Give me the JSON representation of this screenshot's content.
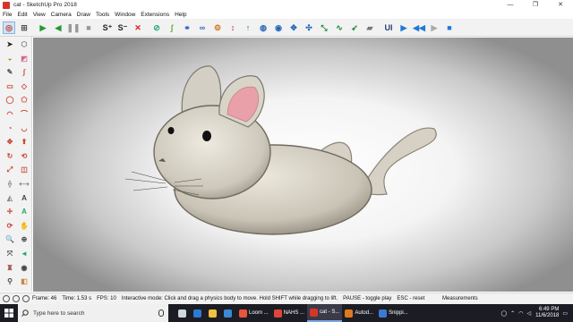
{
  "window": {
    "title": "cat - SketchUp Pro 2018",
    "min": "—",
    "restore": "❐",
    "close": "✕"
  },
  "menu": [
    "File",
    "Edit",
    "View",
    "Camera",
    "Draw",
    "Tools",
    "Window",
    "Extensions",
    "Help"
  ],
  "toolbar": {
    "items": [
      {
        "name": "select-tool",
        "glyph": "◎",
        "color": "#c0392b",
        "selected": true
      },
      {
        "name": "physics-icon",
        "glyph": "⊞",
        "color": "#555"
      },
      {
        "name": "play-button",
        "glyph": "▶",
        "color": "#1e9c2e"
      },
      {
        "name": "step-back-button",
        "glyph": "◀",
        "color": "#1e9c2e"
      },
      {
        "name": "pause-button",
        "glyph": "❚❚",
        "color": "#999"
      },
      {
        "name": "stop-button",
        "glyph": "■",
        "color": "#999"
      },
      {
        "name": "sound-plus-button",
        "glyph": "S⁺",
        "color": "#222"
      },
      {
        "name": "sound-minus-button",
        "glyph": "S⁻",
        "color": "#222"
      },
      {
        "name": "delete-joint-button",
        "glyph": "✕",
        "color": "#d22"
      },
      {
        "name": "reset-icon",
        "glyph": "⊘",
        "color": "#2a7"
      },
      {
        "name": "joint-icon",
        "glyph": "ʃ",
        "color": "#6a3"
      },
      {
        "name": "hinge-icon",
        "glyph": "⚭",
        "color": "#36c"
      },
      {
        "name": "spring-icon",
        "glyph": "∞",
        "color": "#36c"
      },
      {
        "name": "gear-icon",
        "glyph": "⚙",
        "color": "#d4771b"
      },
      {
        "name": "slider-up-icon",
        "glyph": "↕",
        "color": "#c23"
      },
      {
        "name": "piston-icon",
        "glyph": "↑",
        "color": "#1a8a3c"
      },
      {
        "name": "motor-icon",
        "glyph": "◍",
        "color": "#2266b8"
      },
      {
        "name": "servo-icon",
        "glyph": "◉",
        "color": "#2266b8"
      },
      {
        "name": "ball-joint-icon",
        "glyph": "✥",
        "color": "#2266b8"
      },
      {
        "name": "universal-joint-icon",
        "glyph": "✣",
        "color": "#2266b8"
      },
      {
        "name": "fixed-joint-icon",
        "glyph": "⤡",
        "color": "#1a8a3c"
      },
      {
        "name": "curvy-icon",
        "glyph": "∿",
        "color": "#1a8a3c"
      },
      {
        "name": "thruster-icon",
        "glyph": "➶",
        "color": "#1a8a3c"
      },
      {
        "name": "emitter-icon",
        "glyph": "▰",
        "color": "#777"
      },
      {
        "name": "ui-button",
        "glyph": "UI",
        "color": "#223f7a"
      },
      {
        "name": "play-forward-button",
        "glyph": "▶",
        "color": "#1f7ad6"
      },
      {
        "name": "rewind-button",
        "glyph": "◀◀",
        "color": "#1f7ad6"
      },
      {
        "name": "play-small-button",
        "glyph": "▶",
        "color": "#aaa"
      },
      {
        "name": "record-button",
        "glyph": "■",
        "color": "#1f7ad6"
      }
    ]
  },
  "left_tools": [
    {
      "name": "arrow-select-icon",
      "glyph": "➤",
      "color": "#222"
    },
    {
      "name": "component-icon",
      "glyph": "⬡",
      "color": "#777"
    },
    {
      "name": "paint-bucket-icon",
      "glyph": "◒",
      "color": "#b58a00"
    },
    {
      "name": "eraser-icon",
      "glyph": "◩",
      "color": "#d46a8a"
    },
    {
      "name": "pencil-icon",
      "glyph": "✎",
      "color": "#555"
    },
    {
      "name": "freehand-icon",
      "glyph": "∫",
      "color": "#c43"
    },
    {
      "name": "rectangle-icon",
      "glyph": "▭",
      "color": "#c43"
    },
    {
      "name": "rotated-rect-icon",
      "glyph": "◇",
      "color": "#c43"
    },
    {
      "name": "circle-icon",
      "glyph": "◯",
      "color": "#c43"
    },
    {
      "name": "polygon-icon",
      "glyph": "⬠",
      "color": "#c43"
    },
    {
      "name": "arc-icon",
      "glyph": "◠",
      "color": "#c43"
    },
    {
      "name": "arc2-icon",
      "glyph": "⌒",
      "color": "#c43"
    },
    {
      "name": "pie-icon",
      "glyph": "◔",
      "color": "#c43"
    },
    {
      "name": "arc3-icon",
      "glyph": "◡",
      "color": "#c43"
    },
    {
      "name": "move-icon",
      "glyph": "✥",
      "color": "#c43"
    },
    {
      "name": "push-pull-icon",
      "glyph": "⬆",
      "color": "#c43"
    },
    {
      "name": "rotate-icon",
      "glyph": "↻",
      "color": "#c43"
    },
    {
      "name": "follow-me-icon",
      "glyph": "⟲",
      "color": "#c43"
    },
    {
      "name": "scale-icon",
      "glyph": "⤢",
      "color": "#c43"
    },
    {
      "name": "offset-icon",
      "glyph": "◫",
      "color": "#c43"
    },
    {
      "name": "tape-measure-icon",
      "glyph": "⟠",
      "color": "#888"
    },
    {
      "name": "dimension-icon",
      "glyph": "⟷",
      "color": "#888"
    },
    {
      "name": "protractor-icon",
      "glyph": "◭",
      "color": "#888"
    },
    {
      "name": "text-icon",
      "glyph": "A",
      "color": "#444"
    },
    {
      "name": "axes-icon",
      "glyph": "✛",
      "color": "#c43"
    },
    {
      "name": "3d-text-icon",
      "glyph": "A",
      "color": "#2a6"
    },
    {
      "name": "orbit-icon",
      "glyph": "⟳",
      "color": "#c43"
    },
    {
      "name": "pan-icon",
      "glyph": "✋",
      "color": "#a87"
    },
    {
      "name": "zoom-icon",
      "glyph": "🔍",
      "color": "#444"
    },
    {
      "name": "zoom-window-icon",
      "glyph": "⊕",
      "color": "#444"
    },
    {
      "name": "zoom-extents-icon",
      "glyph": "⤧",
      "color": "#444"
    },
    {
      "name": "previous-icon",
      "glyph": "◄",
      "color": "#2a6"
    },
    {
      "name": "position-camera-icon",
      "glyph": "♜",
      "color": "#a55"
    },
    {
      "name": "look-around-icon",
      "glyph": "◉",
      "color": "#444"
    },
    {
      "name": "walk-icon",
      "glyph": "⚲",
      "color": "#444"
    },
    {
      "name": "section-icon",
      "glyph": "◧",
      "color": "#c84"
    }
  ],
  "status": {
    "frame": "Frame: 46",
    "time": "Time: 1.53 s",
    "fps": "FPS: 10",
    "message": "Interactive mode: Click and drag a physics body to move. Hold SHIFT while dragging to lift.",
    "pause": "PAUSE - toggle play",
    "esc": "ESC - reset",
    "measurements": "Measurements"
  },
  "taskbar": {
    "search_placeholder": "Type here to search",
    "apps": [
      {
        "name": "taskbar-task-view",
        "label": "",
        "color": "#cfd8e0"
      },
      {
        "name": "taskbar-edge",
        "label": "",
        "color": "#2a7ad6"
      },
      {
        "name": "taskbar-explorer",
        "label": "",
        "color": "#f0c040"
      },
      {
        "name": "taskbar-store",
        "label": "",
        "color": "#3a8ad6"
      },
      {
        "name": "taskbar-loom",
        "label": "Loom ...",
        "color": "#e8563c"
      },
      {
        "name": "taskbar-chrome",
        "label": "NAHS ...",
        "color": "#e0453a"
      },
      {
        "name": "taskbar-sketchup",
        "label": "cat - S...",
        "color": "#d8342a",
        "active": true
      },
      {
        "name": "taskbar-autodesk",
        "label": "Autod...",
        "color": "#e07820"
      },
      {
        "name": "taskbar-snipping",
        "label": "Snippi...",
        "color": "#3a7ad6"
      }
    ],
    "time": "6:49 PM",
    "date": "11/6/2018"
  }
}
